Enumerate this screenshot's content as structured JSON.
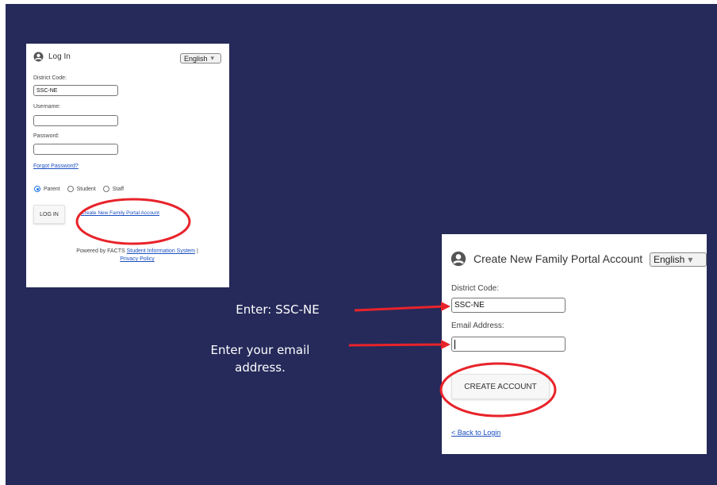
{
  "colors": {
    "background": "#252a5a",
    "annotation": "#e8232a",
    "link": "#1a4fc0",
    "radio_accent": "#1a73e8"
  },
  "login_panel": {
    "title": "Log In",
    "icon": "user-circle-icon",
    "language": "English",
    "district_label": "District Code:",
    "district_value": "SSC-NE",
    "username_label": "Username:",
    "username_value": "",
    "password_label": "Password:",
    "password_value": "",
    "forgot_link": "Forgot Password?",
    "roles": [
      "Parent",
      "Student",
      "Staff"
    ],
    "selected_role": "Parent",
    "login_button": "LOG IN",
    "create_link": "Create New Family Portal Account",
    "powered_prefix": "Powered by FACTS",
    "powered_link": "Student Information System",
    "powered_sep": "|",
    "privacy_link": "Privacy Policy"
  },
  "create_panel": {
    "title": "Create New Family Portal Account",
    "icon": "user-circle-icon",
    "language": "English",
    "district_label": "District Code:",
    "district_value": "SSC-NE",
    "email_label": "Email Address:",
    "email_value": "",
    "create_button": "CREATE ACCOUNT",
    "back_link": "< Back to Login"
  },
  "instructions": {
    "district": "Enter: SSC-NE",
    "email_line1": "Enter your email",
    "email_line2": "address."
  }
}
